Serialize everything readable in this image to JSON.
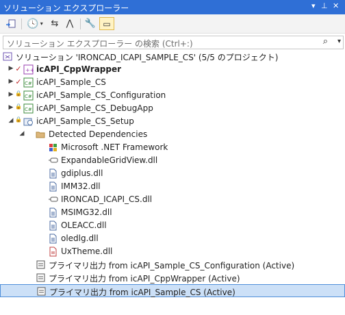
{
  "window": {
    "title": "ソリューション エクスプローラー",
    "pin_glyph": "▾ ⊥ ✕"
  },
  "search": {
    "placeholder": "ソリューション エクスプローラー の検索 (Ctrl+:)"
  },
  "tree": [
    {
      "label": "ソリューション 'IRONCAD_ICAPI_SAMPLE_CS' (5/5 のプロジェクト)",
      "icon": "solution-icon",
      "level": 0,
      "chevron": "",
      "status": ""
    },
    {
      "label": "icAPI_CppWrapper",
      "icon": "cpp-project-icon",
      "level": 1,
      "chevron": "▶",
      "status": "✓",
      "bold": true
    },
    {
      "label": "icAPI_Sample_CS",
      "icon": "cs-project-icon",
      "level": 1,
      "chevron": "▶",
      "status": "✓"
    },
    {
      "label": "icAPI_Sample_CS_Configuration",
      "icon": "cs-project-icon",
      "level": 1,
      "chevron": "▶",
      "status": "🔒"
    },
    {
      "label": "icAPI_Sample_CS_DebugApp",
      "icon": "cs-project-icon",
      "level": 1,
      "chevron": "▶",
      "status": "🔒"
    },
    {
      "label": "icAPI_Sample_CS_Setup",
      "icon": "setup-project-icon",
      "level": 1,
      "chevron": "◢",
      "status": "🔒"
    },
    {
      "label": "Detected Dependencies",
      "icon": "folder-icon",
      "level": 2,
      "chevron": "◢",
      "status": ""
    },
    {
      "label": "Microsoft .NET Framework",
      "icon": "dotnet-icon",
      "level": 3,
      "chevron": "",
      "status": ""
    },
    {
      "label": "ExpandableGridView.dll",
      "icon": "assembly-icon",
      "level": 3,
      "chevron": "",
      "status": ""
    },
    {
      "label": "gdiplus.dll",
      "icon": "file-icon",
      "level": 3,
      "chevron": "",
      "status": ""
    },
    {
      "label": "IMM32.dll",
      "icon": "file-icon",
      "level": 3,
      "chevron": "",
      "status": ""
    },
    {
      "label": "IRONCAD_ICAPI_CS.dll",
      "icon": "assembly-icon",
      "level": 3,
      "chevron": "",
      "status": ""
    },
    {
      "label": "MSIMG32.dll",
      "icon": "file-icon",
      "level": 3,
      "chevron": "",
      "status": ""
    },
    {
      "label": "OLEACC.dll",
      "icon": "file-icon",
      "level": 3,
      "chevron": "",
      "status": ""
    },
    {
      "label": "oledlg.dll",
      "icon": "file-icon",
      "level": 3,
      "chevron": "",
      "status": ""
    },
    {
      "label": "UxTheme.dll",
      "icon": "theme-file-icon",
      "level": 3,
      "chevron": "",
      "status": ""
    },
    {
      "label": "プライマリ出力 from icAPI_Sample_CS_Configuration (Active)",
      "icon": "output-icon",
      "level": 2,
      "chevron": "",
      "status": ""
    },
    {
      "label": "プライマリ出力 from icAPI_CppWrapper (Active)",
      "icon": "output-icon",
      "level": 2,
      "chevron": "",
      "status": ""
    },
    {
      "label": "プライマリ出力 from icAPI_Sample_CS (Active)",
      "icon": "output-icon",
      "level": 2,
      "chevron": "",
      "status": "",
      "selected": true
    }
  ]
}
